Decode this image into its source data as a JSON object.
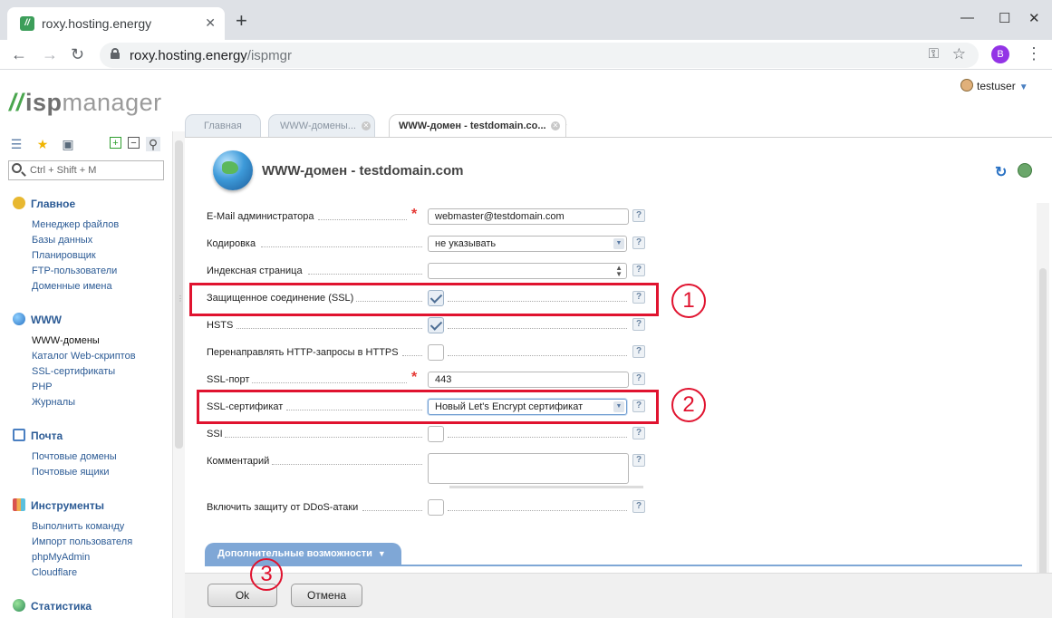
{
  "browser": {
    "tab_title": "roxy.hosting.energy",
    "favicon_letter": "//",
    "url_host": "roxy.hosting.energy",
    "url_path": "/ispmgr",
    "profile_initial": "B"
  },
  "app": {
    "logo_prefix": "isp",
    "logo_suffix": "manager",
    "username": "testuser"
  },
  "sidebar": {
    "search_placeholder": "Ctrl + Shift + M",
    "groups": [
      {
        "title": "Главное",
        "items": [
          "Менеджер файлов",
          "Базы данных",
          "Планировщик",
          "FTP-пользователи",
          "Доменные имена"
        ]
      },
      {
        "title": "WWW",
        "items": [
          "WWW-домены",
          "Каталог Web-скриптов",
          "SSL-сертификаты",
          "PHP",
          "Журналы"
        ]
      },
      {
        "title": "Почта",
        "items": [
          "Почтовые домены",
          "Почтовые ящики"
        ]
      },
      {
        "title": "Инструменты",
        "items": [
          "Выполнить команду",
          "Импорт пользователя",
          "phpMyAdmin",
          "Cloudflare"
        ]
      },
      {
        "title": "Статистика",
        "items": []
      }
    ]
  },
  "tabs": {
    "home": "Главная",
    "domains": "WWW-домены...",
    "current": "WWW-домен - testdomain.co..."
  },
  "form": {
    "title": "WWW-домен - testdomain.com",
    "fields": {
      "email_label": "E-Mail администратора",
      "email_value": "webmaster@testdomain.com",
      "encoding_label": "Кодировка",
      "encoding_value": "не указывать",
      "index_label": "Индексная страница",
      "index_value": "",
      "ssl_label": "Защищенное соединение (SSL)",
      "ssl_checked": true,
      "hsts_label": "HSTS",
      "hsts_checked": true,
      "redirect_label": "Перенаправлять HTTP-запросы в HTTPS",
      "redirect_checked": false,
      "sslport_label": "SSL-порт",
      "sslport_value": "443",
      "sslcert_label": "SSL-сертификат",
      "sslcert_value": "Новый Let's Encrypt сертификат",
      "ssi_label": "SSI",
      "ssi_checked": false,
      "comment_label": "Комментарий",
      "ddos_label": "Включить защиту от DDoS-атаки",
      "ddos_checked": false
    },
    "help_mark": "?",
    "advanced_label": "Дополнительные возможности",
    "ok_label": "Ok",
    "cancel_label": "Отмена"
  },
  "annotations": {
    "marker1": "1",
    "marker2": "2",
    "marker3": "3",
    "color": "#e0132f"
  }
}
